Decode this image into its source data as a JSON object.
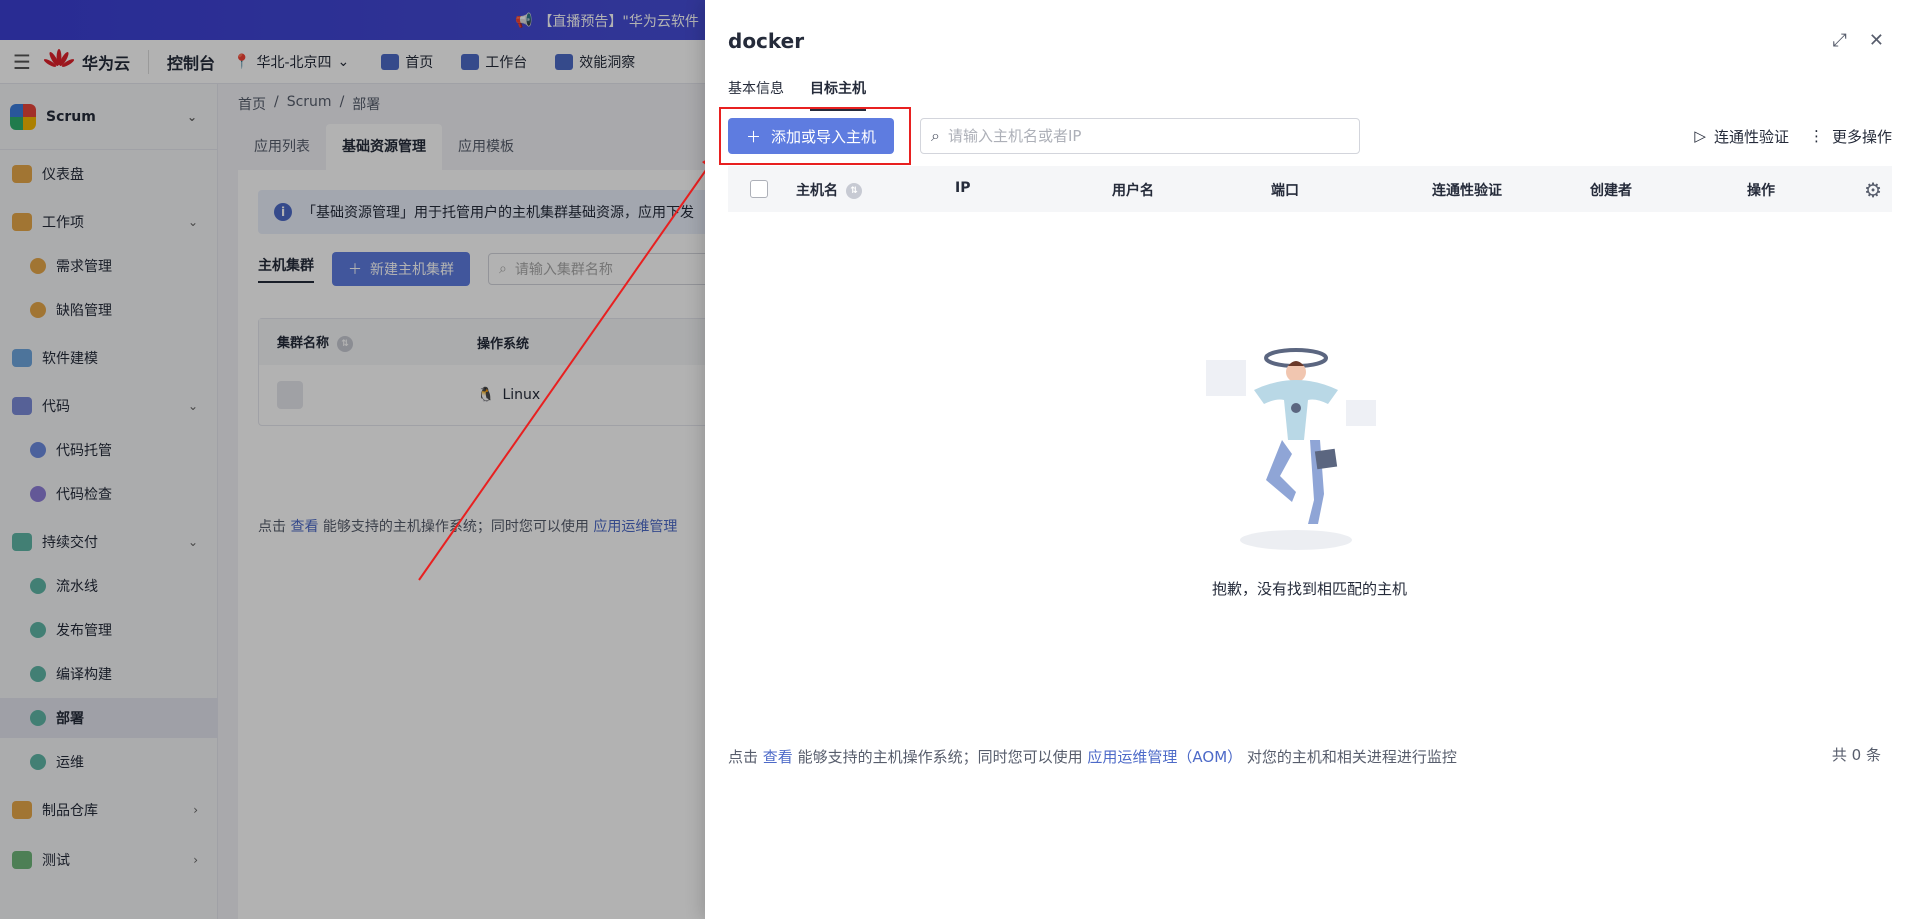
{
  "banner": {
    "text": "【直播预告】\"华为云软件"
  },
  "topbar": {
    "brand": "华为云",
    "console": "控制台",
    "region": "华北-北京四",
    "nav": [
      "首页",
      "工作台",
      "效能洞察"
    ]
  },
  "sidebar": {
    "project": "Scrum",
    "items": [
      {
        "label": "仪表盘"
      },
      {
        "label": "工作项"
      },
      {
        "label": "需求管理"
      },
      {
        "label": "缺陷管理"
      },
      {
        "label": "软件建模"
      },
      {
        "label": "代码"
      },
      {
        "label": "代码托管"
      },
      {
        "label": "代码检查"
      },
      {
        "label": "持续交付"
      },
      {
        "label": "流水线"
      },
      {
        "label": "发布管理"
      },
      {
        "label": "编译构建"
      },
      {
        "label": "部署"
      },
      {
        "label": "运维"
      },
      {
        "label": "制品仓库"
      },
      {
        "label": "测试"
      }
    ]
  },
  "main": {
    "breadcrumb": [
      "首页",
      "/",
      "Scrum",
      "/",
      "部署"
    ],
    "tabs": [
      "应用列表",
      "基础资源管理",
      "应用模板"
    ],
    "info": "「基础资源管理」用于托管用户的主机集群基础资源，应用下发",
    "subtab": "主机集群",
    "new_cluster_button": "新建主机集群",
    "search_placeholder": "请输入集群名称",
    "columns": [
      "集群名称",
      "操作系统"
    ],
    "row_os": "Linux",
    "footer_prefix": "点击",
    "footer_link1": "查看",
    "footer_mid": "能够支持的主机操作系统；同时您可以使用",
    "footer_link2": "应用运维管理"
  },
  "drawer": {
    "title": "docker",
    "tabs": [
      "基本信息",
      "目标主机"
    ],
    "add_button": "添加或导入主机",
    "search_placeholder": "请输入主机名或者IP",
    "connectivity": "连通性验证",
    "more": "更多操作",
    "columns": [
      "主机名",
      "IP",
      "用户名",
      "端口",
      "连通性验证",
      "创建者",
      "操作"
    ],
    "empty_text": "抱歉，没有找到相匹配的主机",
    "footer_prefix": "点击",
    "footer_link1": "查看",
    "footer_mid": "能够支持的主机操作系统；同时您可以使用",
    "footer_link2": "应用运维管理（AOM）",
    "footer_suffix": "对您的主机和相关进程进行监控",
    "total": "共 0 条"
  },
  "colors": {
    "accent": "#5e7ce0",
    "highlight": "#e82020",
    "link": "#4d6ac8"
  }
}
